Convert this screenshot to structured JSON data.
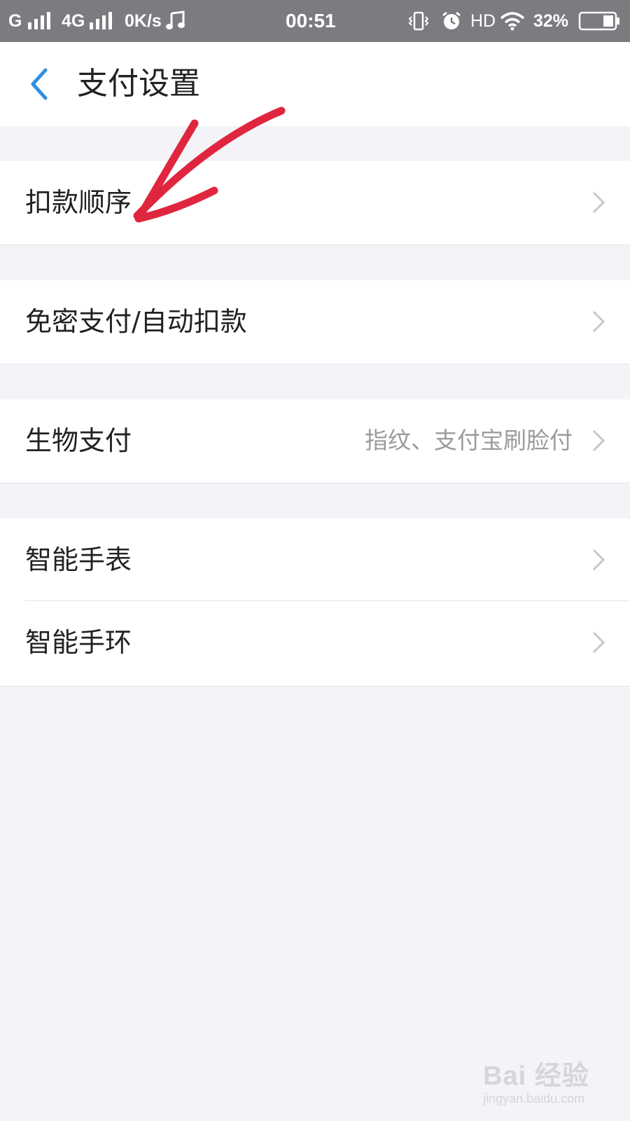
{
  "status_bar": {
    "carrier1": "G",
    "carrier2": "4G",
    "net_speed": "0K/s",
    "time": "00:51",
    "hd": "HD",
    "battery": "32%",
    "icons": [
      "signal-icon",
      "music-note-icon",
      "vibrate-icon",
      "alarm-icon",
      "wifi-icon",
      "battery-icon"
    ]
  },
  "header": {
    "back_icon": "chevron-left-icon",
    "title": "支付设置"
  },
  "settings": {
    "items": [
      {
        "label": "扣款顺序",
        "value": ""
      },
      {
        "label": "免密支付/自动扣款",
        "value": ""
      },
      {
        "label": "生物支付",
        "value": "指纹、支付宝刷脸付"
      },
      {
        "label": "智能手表",
        "value": ""
      },
      {
        "label": "智能手环",
        "value": ""
      }
    ]
  },
  "annotation": {
    "color": "#e0253f",
    "icon": "hand-drawn-arrow"
  },
  "watermark": {
    "brand": "Bai 经验",
    "url": "jingyan.baidu.com"
  },
  "colors": {
    "accent": "#2f8fe0",
    "status_bar": "#7d7b80",
    "background": "#f4f3f7"
  }
}
